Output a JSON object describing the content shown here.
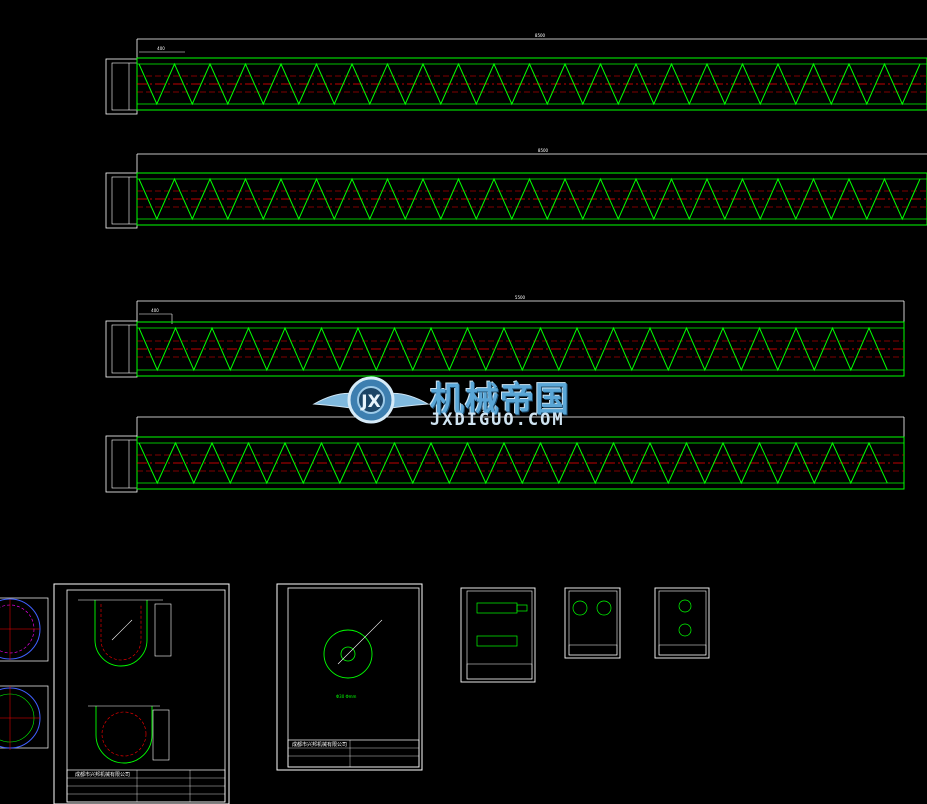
{
  "watermark": {
    "title": "机械帝国",
    "subtitle": "JXDIGUO.COM"
  },
  "conveyors": [
    {
      "id": "A",
      "length_label": "8500",
      "pitch_label": "400"
    },
    {
      "id": "B",
      "length_label": "8500",
      "pitch_label": ""
    },
    {
      "id": "C",
      "length_label": "5500",
      "pitch_label": "400"
    },
    {
      "id": "D",
      "length_label": "",
      "pitch_label": ""
    }
  ],
  "sheets": {
    "sheet1_company": "成都市兴邦机械有限公司",
    "sheet2_company": "成都市兴邦机械有限公司",
    "sheet2_note": "Φ30\nΦmm"
  },
  "colors": {
    "background": "#000000",
    "outline": "#ffffff",
    "flight": "#00ff00",
    "centerline": "#ff0000",
    "dimension": "#00ffff"
  }
}
